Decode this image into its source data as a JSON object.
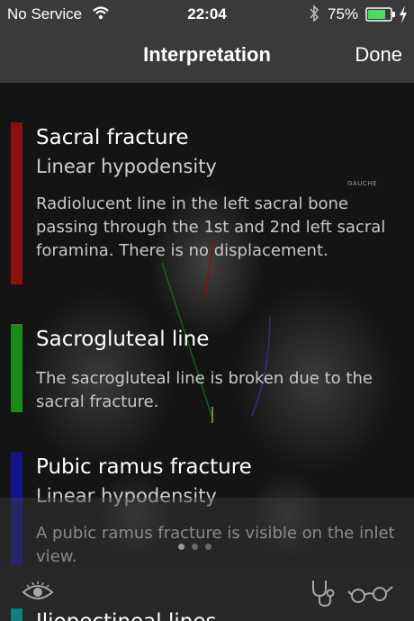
{
  "status": {
    "carrier": "No Service",
    "time": "22:04",
    "battery": "75%"
  },
  "nav": {
    "title": "Interpretation",
    "done_label": "Done"
  },
  "image_label": "GAUCHE",
  "findings": [
    {
      "title": "Sacral fracture",
      "subtitle": "Linear hypodensity",
      "description": "Radiolucent line in the left sacral bone passing through the 1st and 2nd left sacral foramina. There is no displacement.",
      "color": "#8b1010"
    },
    {
      "title": "Sacrogluteal line",
      "subtitle": "",
      "description": "The sacrogluteal line is broken due to the sacral fracture.",
      "color": "#1a8a1a"
    },
    {
      "title": "Pubic ramus fracture",
      "subtitle": "Linear hypodensity",
      "description": "A pubic ramus fracture is visible on the inlet view.",
      "color": "#14148a"
    },
    {
      "title": "Iliopectineal lines",
      "subtitle": "",
      "description": "",
      "color": "#0f8080"
    }
  ],
  "toolbar": {
    "left_icon": "eye-icon",
    "right_icons": [
      "stethoscope-icon",
      "glasses-icon"
    ]
  },
  "pager": {
    "count": 3,
    "active": 0
  }
}
